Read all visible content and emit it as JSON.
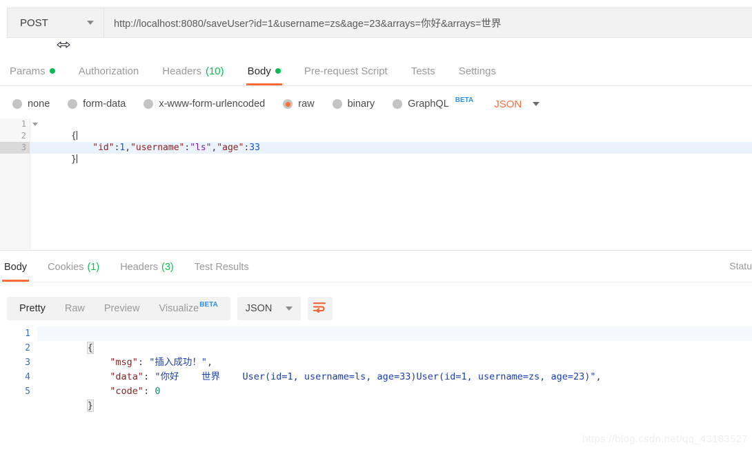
{
  "request_bar": {
    "method": "POST",
    "url": "http://localhost:8080/saveUser?id=1&username=zs&age=23&arrays=你好&arrays=世界",
    "method_caret_icon": "chevron-down-icon",
    "resize_cursor_icon": "horizontal-resize-cursor-icon"
  },
  "request_tabs": [
    {
      "label": "Params",
      "badge_dot": true,
      "active": false
    },
    {
      "label": "Authorization",
      "badge_dot": false,
      "active": false
    },
    {
      "label": "Headers",
      "count": "(10)",
      "active": false
    },
    {
      "label": "Body",
      "badge_dot": true,
      "active": true
    },
    {
      "label": "Pre-request Script",
      "active": false
    },
    {
      "label": "Tests",
      "active": false
    },
    {
      "label": "Settings",
      "active": false
    }
  ],
  "body_types": [
    {
      "label": "none",
      "checked": false
    },
    {
      "label": "form-data",
      "checked": false
    },
    {
      "label": "x-www-form-urlencoded",
      "checked": false
    },
    {
      "label": "raw",
      "checked": true
    },
    {
      "label": "binary",
      "checked": false
    },
    {
      "label": "GraphQL",
      "checked": false,
      "beta": "BETA"
    }
  ],
  "body_format": {
    "selected": "JSON",
    "caret_icon": "chevron-down-icon"
  },
  "request_editor": {
    "line_numbers": [
      "1",
      "2",
      "3"
    ],
    "fold_caret_icon": "fold-triangle-icon",
    "active_line": 3,
    "lines": [
      {
        "n": "1",
        "tokens": [
          {
            "t": "{",
            "c": "brace"
          }
        ]
      },
      {
        "n": "2",
        "tokens": [
          {
            "t": "    ",
            "c": "punc"
          },
          {
            "t": "\"id\"",
            "c": "key"
          },
          {
            "t": ":",
            "c": "punc"
          },
          {
            "t": "1",
            "c": "num"
          },
          {
            "t": ",",
            "c": "punc"
          },
          {
            "t": "\"username\"",
            "c": "key"
          },
          {
            "t": ":",
            "c": "punc"
          },
          {
            "t": "\"ls\"",
            "c": "str"
          },
          {
            "t": ",",
            "c": "punc"
          },
          {
            "t": "\"age\"",
            "c": "key"
          },
          {
            "t": ":",
            "c": "punc"
          },
          {
            "t": "33",
            "c": "num"
          }
        ]
      },
      {
        "n": "3",
        "tokens": [
          {
            "t": "}",
            "c": "brace"
          }
        ]
      }
    ]
  },
  "response_tabs": [
    {
      "label": "Body",
      "active": true
    },
    {
      "label": "Cookies",
      "count": "(1)",
      "active": false
    },
    {
      "label": "Headers",
      "count": "(3)",
      "active": false
    },
    {
      "label": "Test Results",
      "active": false
    }
  ],
  "response_status_partial": "Statu",
  "response_toolbar": {
    "views": [
      {
        "label": "Pretty",
        "active": true
      },
      {
        "label": "Raw",
        "active": false
      },
      {
        "label": "Preview",
        "active": false
      },
      {
        "label": "Visualize",
        "active": false,
        "beta": "BETA"
      }
    ],
    "format_selected": "JSON",
    "format_caret_icon": "chevron-down-icon",
    "wrap_button_icon": "wrap-lines-icon"
  },
  "response_editor": {
    "line_numbers": [
      "1",
      "2",
      "3",
      "4",
      "5"
    ],
    "active_line": 1,
    "lines": [
      {
        "n": "1",
        "tokens": [
          {
            "t": "{",
            "c": "brace"
          }
        ]
      },
      {
        "n": "2",
        "tokens": [
          {
            "t": "    ",
            "c": "punc"
          },
          {
            "t": "\"msg\"",
            "c": "key"
          },
          {
            "t": ": ",
            "c": "punc"
          },
          {
            "t": "\"插入成功！\"",
            "c": "str"
          },
          {
            "t": ",",
            "c": "punc"
          }
        ]
      },
      {
        "n": "3",
        "tokens": [
          {
            "t": "    ",
            "c": "punc"
          },
          {
            "t": "\"data\"",
            "c": "key"
          },
          {
            "t": ": ",
            "c": "punc"
          },
          {
            "t": "\"你好    世界    User(id=1, username=ls, age=33)User(id=1, username=zs, age=23)\"",
            "c": "str"
          },
          {
            "t": ",",
            "c": "punc"
          }
        ]
      },
      {
        "n": "4",
        "tokens": [
          {
            "t": "    ",
            "c": "punc"
          },
          {
            "t": "\"code\"",
            "c": "key"
          },
          {
            "t": ": ",
            "c": "punc"
          },
          {
            "t": "0",
            "c": "num"
          }
        ]
      },
      {
        "n": "5",
        "tokens": [
          {
            "t": "}",
            "c": "brace"
          }
        ]
      }
    ]
  },
  "watermark": "https://blog.csdn.net/qq_43183527",
  "colors": {
    "accent_orange": "#ff6c37",
    "green": "#0cbb52",
    "beta_blue": "#2f8fe0"
  }
}
